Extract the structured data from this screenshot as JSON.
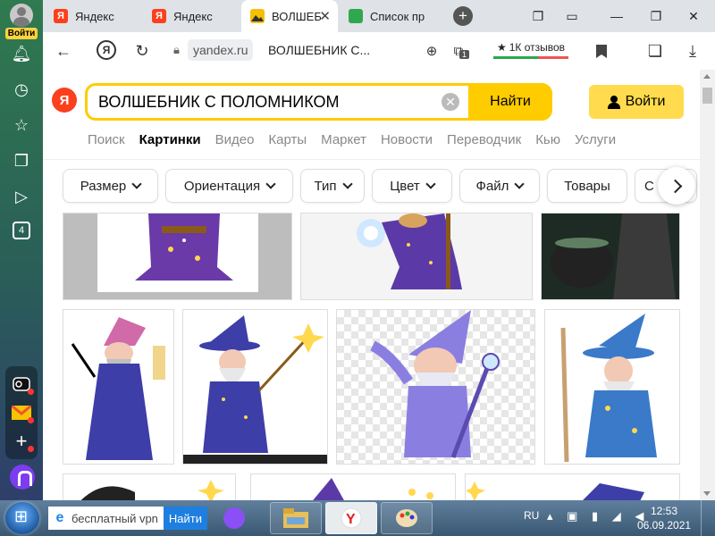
{
  "sidebar": {
    "login_label": "Войти",
    "icons": [
      "bell-icon",
      "history-icon",
      "star-icon",
      "collections-icon",
      "play-icon"
    ],
    "badge_count": "4",
    "dock": [
      "alice-station-icon",
      "mail-icon",
      "add-icon"
    ]
  },
  "tabs": [
    {
      "title": "Яндекс",
      "favicon": "yandex-icon",
      "active": false
    },
    {
      "title": "Яндекс",
      "favicon": "yandex-icon",
      "active": false
    },
    {
      "title": "ВОЛШЕБ",
      "favicon": "images-icon",
      "active": true
    },
    {
      "title": "Список пр",
      "favicon": "list-icon",
      "active": false
    }
  ],
  "toolbar": {
    "domain": "yandex.ru",
    "page_title": "ВОЛШЕБНИК С...",
    "reviews": "1К отзывов",
    "ext_badge": "1"
  },
  "search": {
    "query": "ВОЛШЕБНИК С ПОЛОМНИКОМ",
    "button": "Найти",
    "login": "Войти"
  },
  "nav": {
    "items": [
      "Поиск",
      "Картинки",
      "Видео",
      "Карты",
      "Маркет",
      "Новости",
      "Переводчик",
      "Кью",
      "Услуги"
    ],
    "active": "Картинки"
  },
  "filters": [
    "Размер",
    "Ориентация",
    "Тип",
    "Цвет",
    "Файл",
    "Товары",
    "С"
  ],
  "taskbar": {
    "search_text": "бесплатный vpn",
    "search_button": "Найти",
    "lang": "RU",
    "time": "12:53",
    "date": "06.09.2021"
  },
  "colors": {
    "yandex_red": "#fc3f1d",
    "yandex_yellow": "#ffcc00",
    "wizard_purple": "#5b3aa8"
  }
}
